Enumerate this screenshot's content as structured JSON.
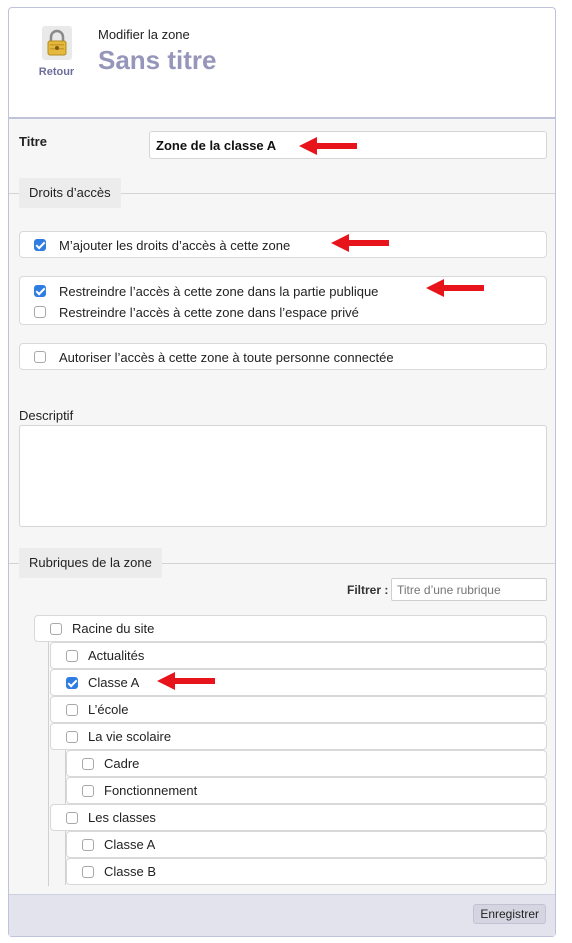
{
  "header": {
    "back_label": "Retour",
    "subtitle": "Modifier la zone",
    "title": "Sans titre"
  },
  "form": {
    "title_label": "Titre",
    "title_value": "Zone de la classe A",
    "access_legend": "Droits d’accès",
    "add_rights": {
      "label": "M’ajouter les droits d’accès à cette zone",
      "checked": true
    },
    "restrict_public": {
      "label": "Restreindre l’accès à cette zone dans la partie publique",
      "checked": true
    },
    "restrict_private": {
      "label": "Restreindre l’accès à cette zone dans l’espace privé",
      "checked": false
    },
    "authorize_connected": {
      "label": "Autoriser l’accès à cette zone à toute personne connectée",
      "checked": false
    },
    "description_label": "Descriptif",
    "description_value": "",
    "sections_legend": "Rubriques de la zone",
    "filter_label": "Filtrer :",
    "filter_placeholder": "Titre d’une rubrique",
    "tree": [
      {
        "label": "Racine du site",
        "level": 0,
        "checked": false
      },
      {
        "label": "Actualités",
        "level": 1,
        "checked": false
      },
      {
        "label": "Classe A",
        "level": 1,
        "checked": true
      },
      {
        "label": "L’école",
        "level": 1,
        "checked": false
      },
      {
        "label": "La vie scolaire",
        "level": 1,
        "checked": false
      },
      {
        "label": "Cadre",
        "level": 2,
        "checked": false
      },
      {
        "label": "Fonctionnement",
        "level": 2,
        "checked": false
      },
      {
        "label": "Les classes",
        "level": 1,
        "checked": false
      },
      {
        "label": "Classe A",
        "level": 2,
        "checked": false
      },
      {
        "label": "Classe B",
        "level": 2,
        "checked": false
      }
    ],
    "save_label": "Enregistrer"
  },
  "colors": {
    "title_color": "#9696bb",
    "checkbox_checked": "#2f7de1",
    "annotation_arrow": "#e8141c"
  },
  "icons": {
    "back": "lock-icon",
    "annotation": "red-arrow-icon"
  }
}
